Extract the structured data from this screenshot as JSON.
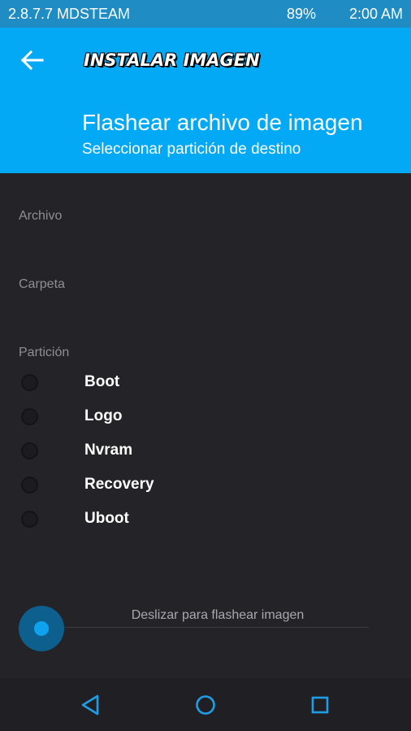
{
  "status_bar": {
    "left_text": "2.8.7.7 MDSTEAM",
    "battery": "89%",
    "time": "2:00 AM"
  },
  "header": {
    "app_title": "INSTALAR IMAGEN",
    "title": "Flashear archivo de imagen",
    "subtitle": "Seleccionar partición de destino"
  },
  "sections": {
    "file_label": "Archivo",
    "folder_label": "Carpeta",
    "partition_label": "Partición"
  },
  "partitions": [
    {
      "label": "Boot",
      "selected": false
    },
    {
      "label": "Logo",
      "selected": false
    },
    {
      "label": "Nvram",
      "selected": false
    },
    {
      "label": "Recovery",
      "selected": false
    },
    {
      "label": "Uboot",
      "selected": false
    }
  ],
  "slider": {
    "label": "Deslizar para flashear imagen"
  },
  "nav": {
    "back_icon": "triangle-back-icon",
    "home_icon": "circle-home-icon",
    "recents_icon": "square-recents-icon"
  },
  "colors": {
    "header_bg": "#03a9f4",
    "status_bg": "#1f8cc4",
    "body_bg": "#232328",
    "accent": "#0fa3ef",
    "nav_icon": "#1e9ee6"
  }
}
